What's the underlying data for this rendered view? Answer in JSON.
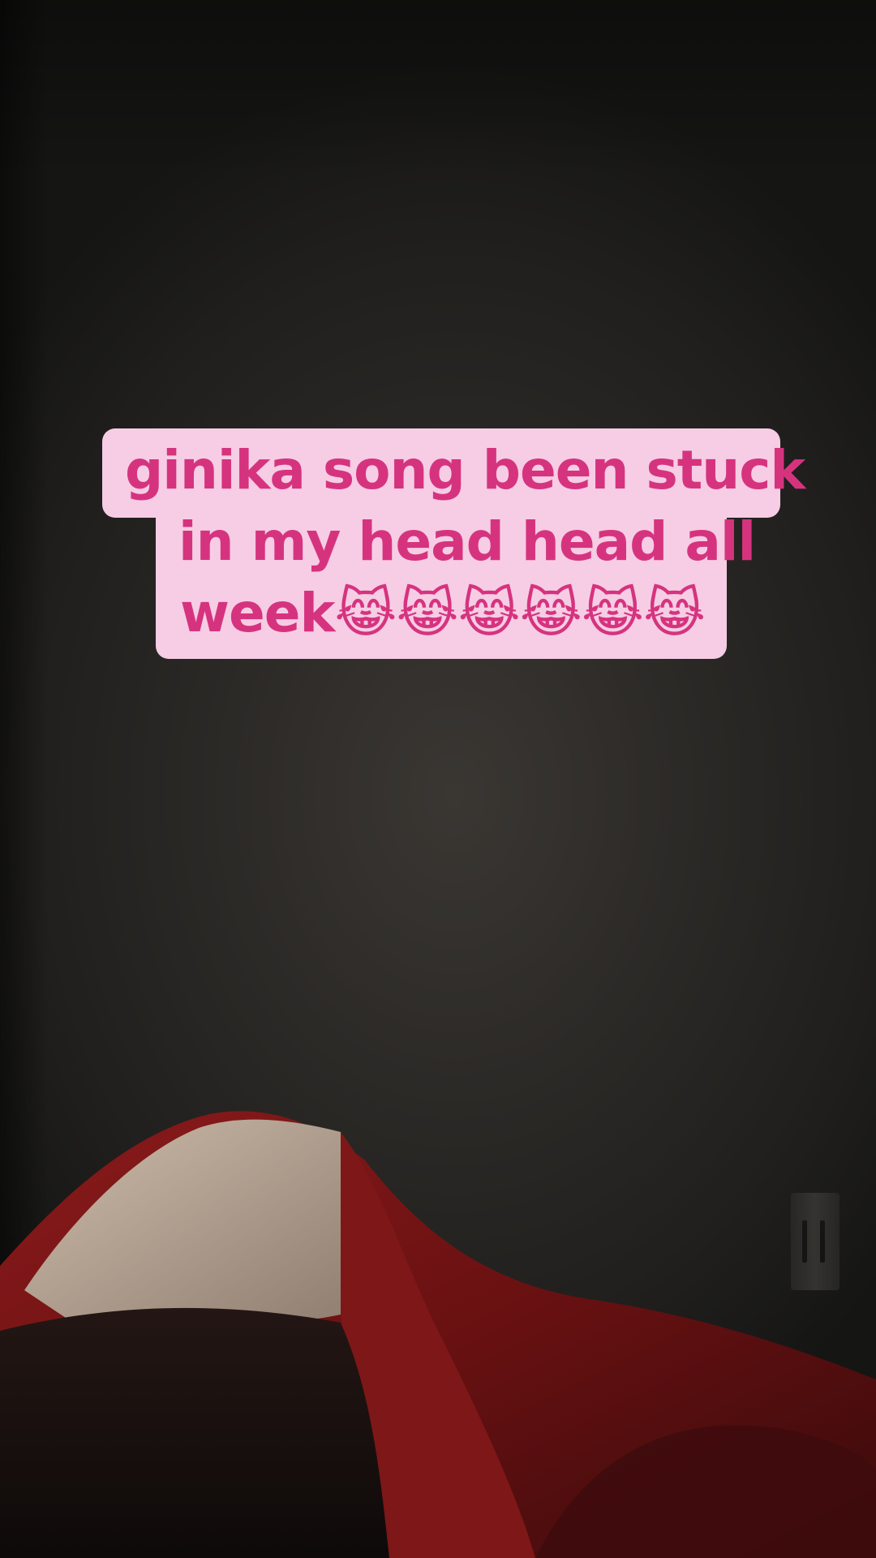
{
  "caption": {
    "line1": "ginika song been stuck",
    "line2": "in my head head all",
    "line3": "week😹😹😹😹😹😹"
  },
  "colors": {
    "caption_background": "#f6cde4",
    "caption_text": "#d6337f",
    "wall": "#2c2a27",
    "blanket_red": "#7a1516",
    "blanket_lining": "#c9b8a8"
  }
}
